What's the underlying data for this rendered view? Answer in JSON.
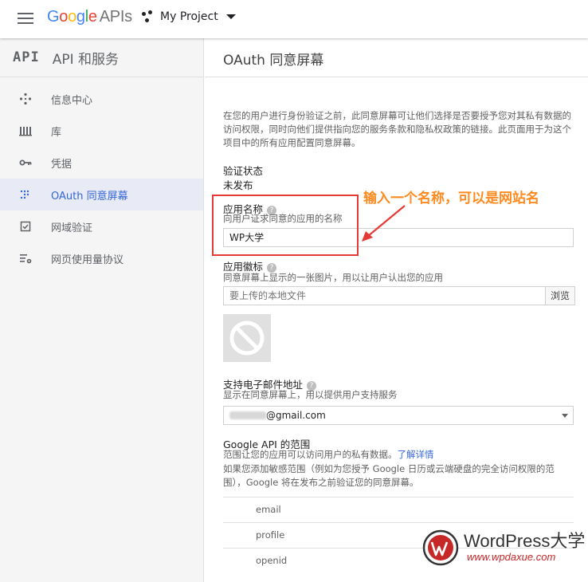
{
  "header": {
    "logo_google": "Google",
    "logo_apis": "APIs",
    "project_name": "My Project"
  },
  "colors": {
    "google_blue": "#4285F4",
    "google_red": "#EA4335",
    "google_yellow": "#FBBC05",
    "google_green": "#34A853",
    "accent": "#3367d6",
    "annotation_orange": "#ff8a1f",
    "annotation_red": "#e53935"
  },
  "sidebar": {
    "badge": "API",
    "title": "API 和服务",
    "items": [
      {
        "label": "信息中心",
        "icon": "dashboard-icon",
        "active": false
      },
      {
        "label": "库",
        "icon": "library-icon",
        "active": false
      },
      {
        "label": "凭据",
        "icon": "key-icon",
        "active": false
      },
      {
        "label": "OAuth 同意屏幕",
        "icon": "consent-dots-icon",
        "active": true
      },
      {
        "label": "网域验证",
        "icon": "checkbox-icon",
        "active": false
      },
      {
        "label": "网页使用量协议",
        "icon": "list-settings-icon",
        "active": false
      }
    ]
  },
  "main": {
    "title": "OAuth 同意屏幕",
    "description": "在您的用户进行身份验证之前，此同意屏幕可让他们选择是否要授予您对其私有数据的访问权限，同时向他们提供指向您的服务条款和隐私权政策的链接。此页面用于为这个项目中的所有应用配置同意屏幕。",
    "verification_label": "验证状态",
    "verification_value": "未发布",
    "app_name": {
      "label": "应用名称",
      "sub": "向用户证求同意的应用的名称",
      "value": "WP大学"
    },
    "app_logo": {
      "label": "应用徽标",
      "sub": "同意屏幕上显示的一张图片，用以让用户认出您的应用",
      "placeholder": "要上传的本地文件",
      "browse_label": "浏览"
    },
    "support_email": {
      "label": "支持电子邮件地址",
      "sub": "显示在同意屏幕上，用以提供用户支持服务",
      "value": "@gmail.com"
    },
    "scopes": {
      "label": "Google API 的范围",
      "sub": "范围让您的应用可以访问用户的私有数据。",
      "learn_more": "了解详情",
      "sensitive_note": "如果您添加敏感范围（例如为您授予 Google 日历或云端硬盘的完全访问权限的范围），Google 将在发布之前验证您的同意屏幕。",
      "items": [
        "email",
        "profile",
        "openid"
      ]
    }
  },
  "annotation": {
    "text": "输入一个名称，可以是网站名"
  },
  "watermark": {
    "title": "WordPress大学",
    "url": "www.wpdaxue.com"
  }
}
